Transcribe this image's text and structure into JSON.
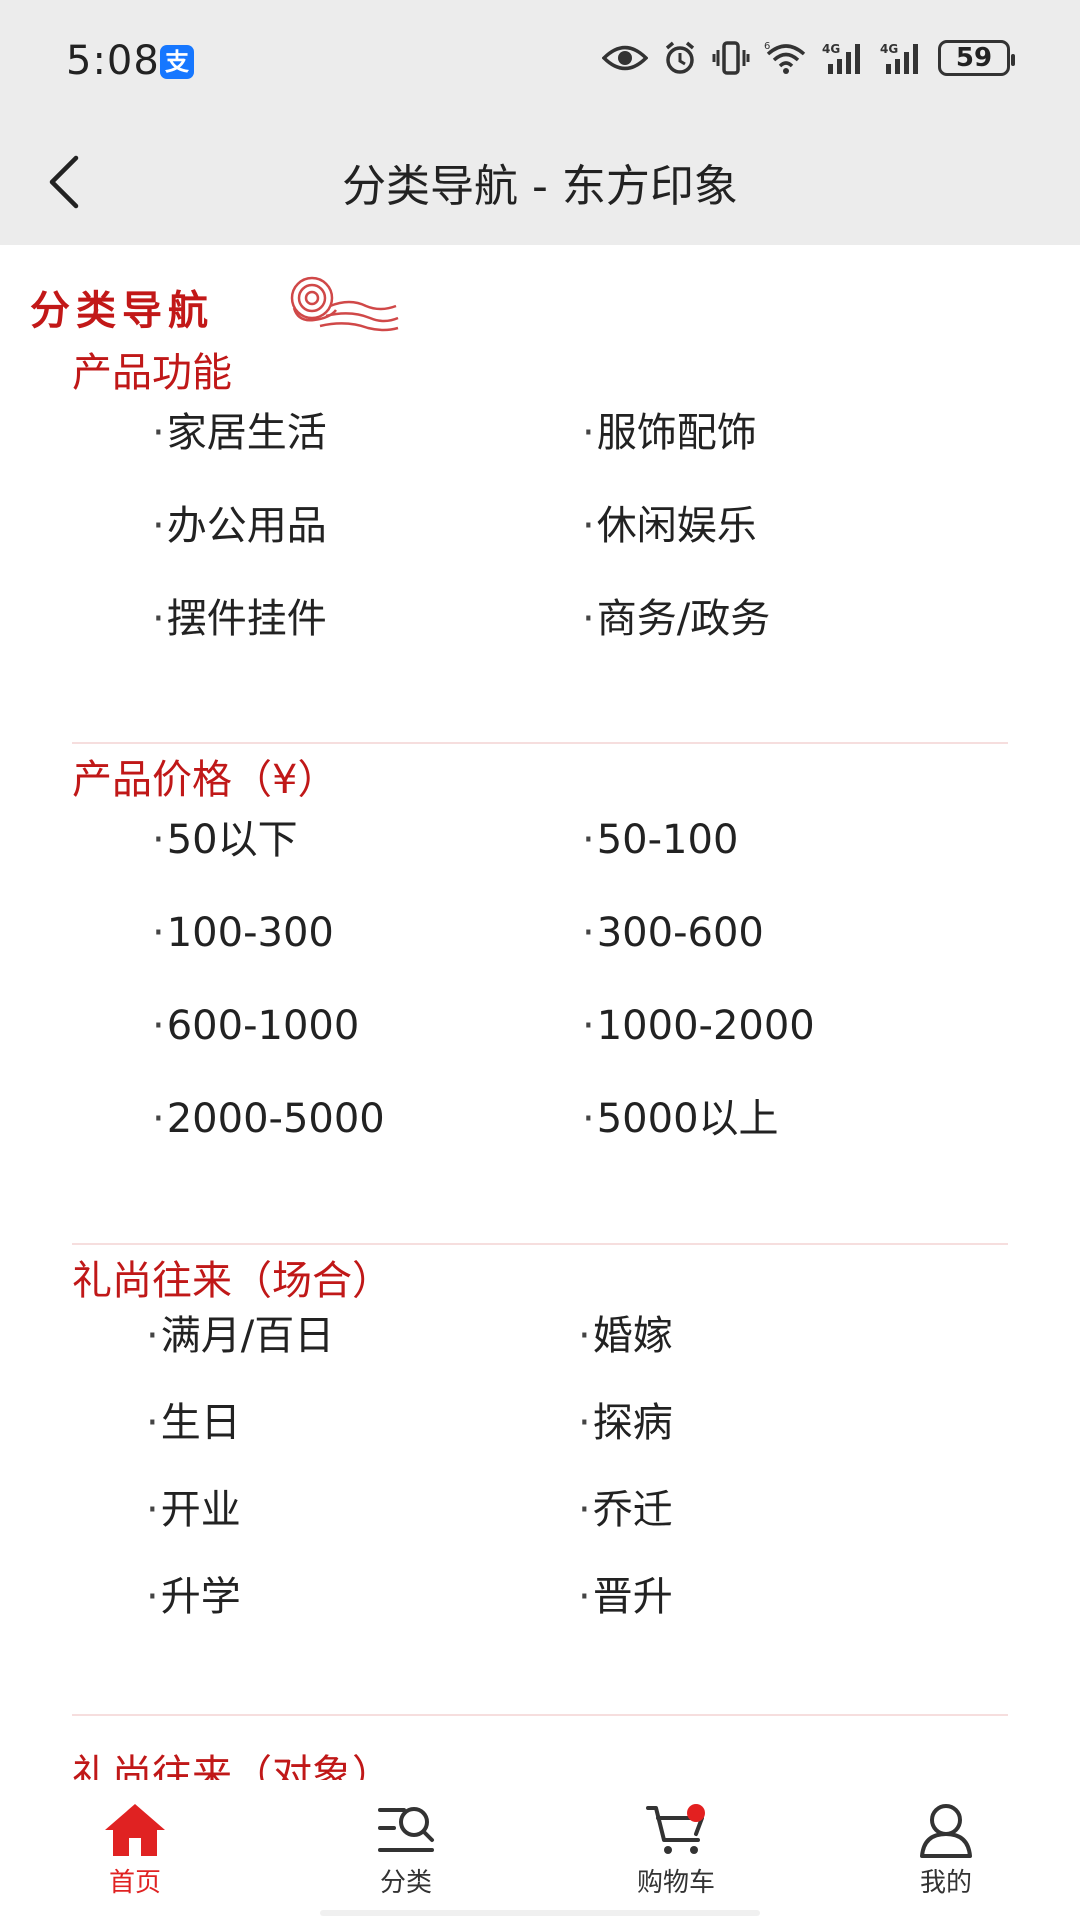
{
  "status_bar": {
    "time": "5:08",
    "alipay_badge": "支",
    "battery_level": "59",
    "network_1": "4G",
    "network_2": "4G",
    "wifi_tag": "6"
  },
  "nav": {
    "title": "分类导航 - 东方印象"
  },
  "logo": {
    "text": "分类导航"
  },
  "sections": [
    {
      "title": "产品功能",
      "items": [
        "家居生活",
        "服饰配饰",
        "办公用品",
        "休闲娱乐",
        "摆件挂件",
        "商务/政务"
      ]
    },
    {
      "title": "产品价格（¥）",
      "items": [
        "50以下",
        "50-100",
        "100-300",
        "300-600",
        "600-1000",
        "1000-2000",
        "2000-5000",
        "5000以上"
      ]
    },
    {
      "title": "礼尚往来（场合）",
      "items": [
        "满月/百日",
        "婚嫁",
        "生日",
        "探病",
        "开业",
        "乔迁",
        "升学",
        "晋升"
      ]
    },
    {
      "title": "礼尚往来（对象）",
      "items": []
    }
  ],
  "tabbar": {
    "tabs": [
      {
        "label": "首页",
        "icon": "home-icon",
        "active": true
      },
      {
        "label": "分类",
        "icon": "category-search-icon",
        "active": false
      },
      {
        "label": "购物车",
        "icon": "cart-icon",
        "active": false
      },
      {
        "label": "我的",
        "icon": "user-icon",
        "active": false
      }
    ]
  },
  "colors": {
    "accent": "#c01818",
    "active_tab": "#e02222",
    "bar_bg": "#ececec",
    "divider": "#f6dede"
  }
}
